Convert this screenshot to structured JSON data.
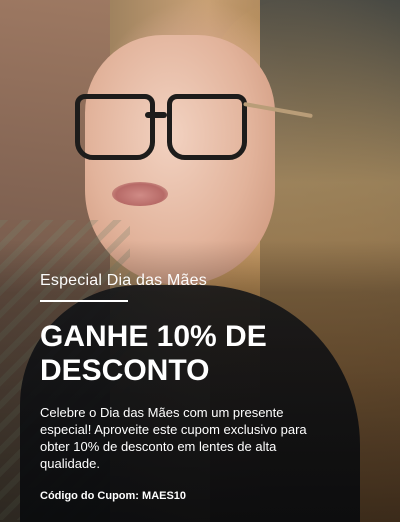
{
  "promo": {
    "eyebrow": "Especial Dia das Mães",
    "headline_line1": "GANHE 10% DE",
    "headline_line2": "DESCONTO",
    "body": "Celebre o Dia das Mães com um presente especial! Aproveite este cupom exclusivo para obter 10% de desconto em lentes de alta qualidade.",
    "coupon": "Código do Cupom: MAES10"
  },
  "colors": {
    "text": "#FFFFFF",
    "overlay_dark": "#14171C"
  }
}
